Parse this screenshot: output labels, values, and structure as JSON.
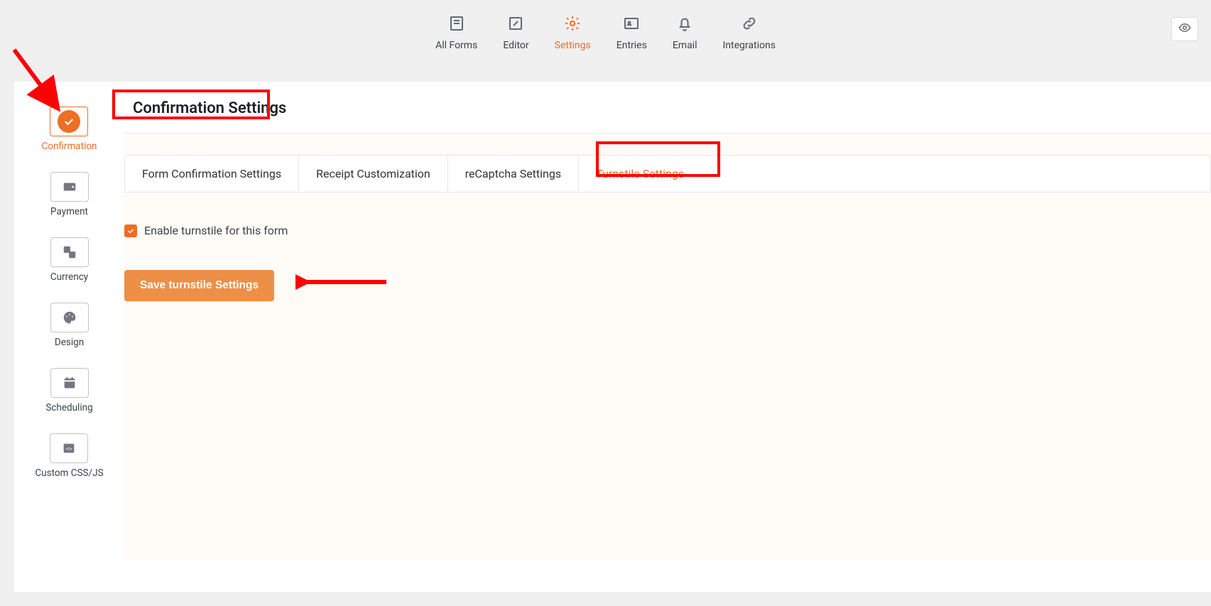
{
  "topnav": {
    "items": [
      {
        "label": "All Forms"
      },
      {
        "label": "Editor"
      },
      {
        "label": "Settings"
      },
      {
        "label": "Entries"
      },
      {
        "label": "Email"
      },
      {
        "label": "Integrations"
      }
    ]
  },
  "sidebar": {
    "items": [
      {
        "label": "Confirmation"
      },
      {
        "label": "Payment"
      },
      {
        "label": "Currency"
      },
      {
        "label": "Design"
      },
      {
        "label": "Scheduling"
      },
      {
        "label": "Custom CSS/JS"
      }
    ]
  },
  "page": {
    "title": "Confirmation Settings"
  },
  "tabs": [
    {
      "label": "Form Confirmation Settings"
    },
    {
      "label": "Receipt Customization"
    },
    {
      "label": "reCaptcha Settings"
    },
    {
      "label": "Turnstile Settings"
    }
  ],
  "form": {
    "enable_label": "Enable turnstile for this form",
    "save_button": "Save turnstile Settings"
  }
}
